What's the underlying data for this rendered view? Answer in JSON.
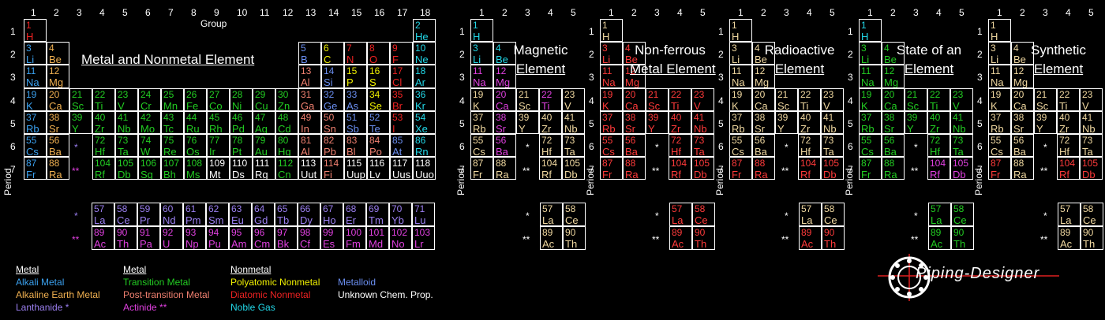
{
  "colors": {
    "alkali_metal": "#3aa0ee",
    "alkaline_earth_metal": "#f0b050",
    "lanthanide": "#9b7ff0",
    "transition_metal": "#22cc22",
    "post_transition_metal": "#f08070",
    "actinide": "#e040e0",
    "polyatomic_nonmetal": "#f0f000",
    "diatomic_nonmetal": "#ee2222",
    "noble_gas": "#22d8e8",
    "metalloid": "#6a8ef0",
    "unknown": "#ffffff",
    "panel_highlight": "#ff3a3a",
    "panel_plain": "#f0d8a0"
  },
  "main": {
    "group_label": "Group",
    "period_label": "Period",
    "title": "Metal and Nonmetal Element",
    "group_numbers": [
      "1",
      "2",
      "3",
      "4",
      "5",
      "6",
      "7",
      "8",
      "9",
      "10",
      "11",
      "12",
      "13",
      "14",
      "15",
      "16",
      "17",
      "18"
    ],
    "period_numbers": [
      "1",
      "2",
      "3",
      "4",
      "5",
      "6",
      "7"
    ],
    "lanthanide_marker": "*",
    "actinide_marker": "**"
  },
  "elements": [
    {
      "n": "1",
      "s": "H",
      "p": 1,
      "g": 1,
      "c": "diatomic_nonmetal"
    },
    {
      "n": "2",
      "s": "He",
      "p": 1,
      "g": 18,
      "c": "noble_gas"
    },
    {
      "n": "3",
      "s": "Li",
      "p": 2,
      "g": 1,
      "c": "alkali_metal"
    },
    {
      "n": "4",
      "s": "Be",
      "p": 2,
      "g": 2,
      "c": "alkaline_earth_metal"
    },
    {
      "n": "5",
      "s": "B",
      "p": 2,
      "g": 13,
      "c": "metalloid"
    },
    {
      "n": "6",
      "s": "C",
      "p": 2,
      "g": 14,
      "c": "polyatomic_nonmetal"
    },
    {
      "n": "7",
      "s": "N",
      "p": 2,
      "g": 15,
      "c": "diatomic_nonmetal"
    },
    {
      "n": "8",
      "s": "O",
      "p": 2,
      "g": 16,
      "c": "diatomic_nonmetal"
    },
    {
      "n": "9",
      "s": "F",
      "p": 2,
      "g": 17,
      "c": "diatomic_nonmetal"
    },
    {
      "n": "10",
      "s": "Ne",
      "p": 2,
      "g": 18,
      "c": "noble_gas"
    },
    {
      "n": "11",
      "s": "Na",
      "p": 3,
      "g": 1,
      "c": "alkali_metal"
    },
    {
      "n": "12",
      "s": "Mg",
      "p": 3,
      "g": 2,
      "c": "alkaline_earth_metal"
    },
    {
      "n": "13",
      "s": "Al",
      "p": 3,
      "g": 13,
      "c": "post_transition_metal"
    },
    {
      "n": "14",
      "s": "Si",
      "p": 3,
      "g": 14,
      "c": "metalloid"
    },
    {
      "n": "15",
      "s": "P",
      "p": 3,
      "g": 15,
      "c": "polyatomic_nonmetal"
    },
    {
      "n": "16",
      "s": "S",
      "p": 3,
      "g": 16,
      "c": "polyatomic_nonmetal"
    },
    {
      "n": "17",
      "s": "Cl",
      "p": 3,
      "g": 17,
      "c": "diatomic_nonmetal"
    },
    {
      "n": "18",
      "s": "Ar",
      "p": 3,
      "g": 18,
      "c": "noble_gas"
    },
    {
      "n": "19",
      "s": "K",
      "p": 4,
      "g": 1,
      "c": "alkali_metal"
    },
    {
      "n": "20",
      "s": "Ca",
      "p": 4,
      "g": 2,
      "c": "alkaline_earth_metal"
    },
    {
      "n": "21",
      "s": "Sc",
      "p": 4,
      "g": 3,
      "c": "transition_metal"
    },
    {
      "n": "22",
      "s": "Ti",
      "p": 4,
      "g": 4,
      "c": "transition_metal"
    },
    {
      "n": "23",
      "s": "V",
      "p": 4,
      "g": 5,
      "c": "transition_metal"
    },
    {
      "n": "24",
      "s": "Cr",
      "p": 4,
      "g": 6,
      "c": "transition_metal"
    },
    {
      "n": "25",
      "s": "Mn",
      "p": 4,
      "g": 7,
      "c": "transition_metal"
    },
    {
      "n": "26",
      "s": "Fe",
      "p": 4,
      "g": 8,
      "c": "transition_metal"
    },
    {
      "n": "27",
      "s": "Co",
      "p": 4,
      "g": 9,
      "c": "transition_metal"
    },
    {
      "n": "28",
      "s": "Ni",
      "p": 4,
      "g": 10,
      "c": "transition_metal"
    },
    {
      "n": "29",
      "s": "Cu",
      "p": 4,
      "g": 11,
      "c": "transition_metal"
    },
    {
      "n": "30",
      "s": "Zn",
      "p": 4,
      "g": 12,
      "c": "transition_metal"
    },
    {
      "n": "31",
      "s": "Ga",
      "p": 4,
      "g": 13,
      "c": "post_transition_metal"
    },
    {
      "n": "32",
      "s": "Ge",
      "p": 4,
      "g": 14,
      "c": "metalloid"
    },
    {
      "n": "33",
      "s": "As",
      "p": 4,
      "g": 15,
      "c": "metalloid"
    },
    {
      "n": "34",
      "s": "Se",
      "p": 4,
      "g": 16,
      "c": "polyatomic_nonmetal"
    },
    {
      "n": "35",
      "s": "Br",
      "p": 4,
      "g": 17,
      "c": "diatomic_nonmetal"
    },
    {
      "n": "36",
      "s": "Kr",
      "p": 4,
      "g": 18,
      "c": "noble_gas"
    },
    {
      "n": "37",
      "s": "Rb",
      "p": 5,
      "g": 1,
      "c": "alkali_metal"
    },
    {
      "n": "38",
      "s": "Sr",
      "p": 5,
      "g": 2,
      "c": "alkaline_earth_metal"
    },
    {
      "n": "39",
      "s": "Y",
      "p": 5,
      "g": 3,
      "c": "transition_metal"
    },
    {
      "n": "40",
      "s": "Zr",
      "p": 5,
      "g": 4,
      "c": "transition_metal"
    },
    {
      "n": "41",
      "s": "Nb",
      "p": 5,
      "g": 5,
      "c": "transition_metal"
    },
    {
      "n": "42",
      "s": "Mo",
      "p": 5,
      "g": 6,
      "c": "transition_metal"
    },
    {
      "n": "43",
      "s": "Tc",
      "p": 5,
      "g": 7,
      "c": "transition_metal"
    },
    {
      "n": "44",
      "s": "Ru",
      "p": 5,
      "g": 8,
      "c": "transition_metal"
    },
    {
      "n": "45",
      "s": "Rh",
      "p": 5,
      "g": 9,
      "c": "transition_metal"
    },
    {
      "n": "46",
      "s": "Pd",
      "p": 5,
      "g": 10,
      "c": "transition_metal"
    },
    {
      "n": "47",
      "s": "Ag",
      "p": 5,
      "g": 11,
      "c": "transition_metal"
    },
    {
      "n": "48",
      "s": "Cd",
      "p": 5,
      "g": 12,
      "c": "transition_metal"
    },
    {
      "n": "49",
      "s": "In",
      "p": 5,
      "g": 13,
      "c": "post_transition_metal"
    },
    {
      "n": "50",
      "s": "Sn",
      "p": 5,
      "g": 14,
      "c": "post_transition_metal"
    },
    {
      "n": "51",
      "s": "Sb",
      "p": 5,
      "g": 15,
      "c": "metalloid"
    },
    {
      "n": "52",
      "s": "Te",
      "p": 5,
      "g": 16,
      "c": "metalloid"
    },
    {
      "n": "53",
      "s": "I",
      "p": 5,
      "g": 17,
      "c": "diatomic_nonmetal"
    },
    {
      "n": "54",
      "s": "Xe",
      "p": 5,
      "g": 18,
      "c": "noble_gas"
    },
    {
      "n": "55",
      "s": "Cs",
      "p": 6,
      "g": 1,
      "c": "alkali_metal"
    },
    {
      "n": "56",
      "s": "Ba",
      "p": 6,
      "g": 2,
      "c": "alkaline_earth_metal"
    },
    {
      "n": "72",
      "s": "Hf",
      "p": 6,
      "g": 4,
      "c": "transition_metal"
    },
    {
      "n": "73",
      "s": "Ta",
      "p": 6,
      "g": 5,
      "c": "transition_metal"
    },
    {
      "n": "74",
      "s": "W",
      "p": 6,
      "g": 6,
      "c": "transition_metal"
    },
    {
      "n": "75",
      "s": "Re",
      "p": 6,
      "g": 7,
      "c": "transition_metal"
    },
    {
      "n": "76",
      "s": "Os",
      "p": 6,
      "g": 8,
      "c": "transition_metal"
    },
    {
      "n": "77",
      "s": "Ir",
      "p": 6,
      "g": 9,
      "c": "transition_metal"
    },
    {
      "n": "78",
      "s": "Pt",
      "p": 6,
      "g": 10,
      "c": "transition_metal"
    },
    {
      "n": "79",
      "s": "Au",
      "p": 6,
      "g": 11,
      "c": "transition_metal"
    },
    {
      "n": "80",
      "s": "Hg",
      "p": 6,
      "g": 12,
      "c": "transition_metal"
    },
    {
      "n": "81",
      "s": "Al",
      "p": 6,
      "g": 13,
      "c": "post_transition_metal"
    },
    {
      "n": "82",
      "s": "Pb",
      "p": 6,
      "g": 14,
      "c": "post_transition_metal"
    },
    {
      "n": "83",
      "s": "Bl",
      "p": 6,
      "g": 15,
      "c": "post_transition_metal"
    },
    {
      "n": "84",
      "s": "Po",
      "p": 6,
      "g": 16,
      "c": "post_transition_metal"
    },
    {
      "n": "85",
      "s": "At",
      "p": 6,
      "g": 17,
      "c": "metalloid"
    },
    {
      "n": "86",
      "s": "Rn",
      "p": 6,
      "g": 18,
      "c": "noble_gas"
    },
    {
      "n": "87",
      "s": "Fr",
      "p": 7,
      "g": 1,
      "c": "alkali_metal"
    },
    {
      "n": "88",
      "s": "Ra",
      "p": 7,
      "g": 2,
      "c": "alkaline_earth_metal"
    },
    {
      "n": "104",
      "s": "Rf",
      "p": 7,
      "g": 4,
      "c": "transition_metal"
    },
    {
      "n": "105",
      "s": "Db",
      "p": 7,
      "g": 5,
      "c": "transition_metal"
    },
    {
      "n": "106",
      "s": "Sg",
      "p": 7,
      "g": 6,
      "c": "transition_metal"
    },
    {
      "n": "107",
      "s": "Bh",
      "p": 7,
      "g": 7,
      "c": "transition_metal"
    },
    {
      "n": "108",
      "s": "Ms",
      "p": 7,
      "g": 8,
      "c": "transition_metal"
    },
    {
      "n": "109",
      "s": "Mt",
      "p": 7,
      "g": 9,
      "c": "unknown"
    },
    {
      "n": "110",
      "s": "Ds",
      "p": 7,
      "g": 10,
      "c": "unknown"
    },
    {
      "n": "111",
      "s": "Rg",
      "p": 7,
      "g": 11,
      "c": "unknown"
    },
    {
      "n": "112",
      "s": "Cn",
      "p": 7,
      "g": 12,
      "c": "transition_metal"
    },
    {
      "n": "113",
      "s": "Uut",
      "p": 7,
      "g": 13,
      "c": "unknown"
    },
    {
      "n": "114",
      "s": "Fi",
      "p": 7,
      "g": 14,
      "c": "post_transition_metal"
    },
    {
      "n": "115",
      "s": "Uup",
      "p": 7,
      "g": 15,
      "c": "unknown"
    },
    {
      "n": "116",
      "s": "Lv",
      "p": 7,
      "g": 16,
      "c": "unknown"
    },
    {
      "n": "117",
      "s": "Uus",
      "p": 7,
      "g": 17,
      "c": "unknown"
    },
    {
      "n": "118",
      "s": "Uuo",
      "p": 7,
      "g": 18,
      "c": "unknown"
    }
  ],
  "lanthanides": [
    {
      "n": "57",
      "s": "La"
    },
    {
      "n": "58",
      "s": "Ce"
    },
    {
      "n": "59",
      "s": "Pr"
    },
    {
      "n": "60",
      "s": "Nd"
    },
    {
      "n": "61",
      "s": "Pm"
    },
    {
      "n": "62",
      "s": "Sm"
    },
    {
      "n": "63",
      "s": "Eu"
    },
    {
      "n": "64",
      "s": "Gd"
    },
    {
      "n": "65",
      "s": "Tb"
    },
    {
      "n": "66",
      "s": "Dy"
    },
    {
      "n": "67",
      "s": "Ho"
    },
    {
      "n": "68",
      "s": "Er"
    },
    {
      "n": "69",
      "s": "Tm"
    },
    {
      "n": "70",
      "s": "Yb"
    },
    {
      "n": "71",
      "s": "Lu"
    }
  ],
  "actinides": [
    {
      "n": "89",
      "s": "Ac"
    },
    {
      "n": "90",
      "s": "Th"
    },
    {
      "n": "91",
      "s": "Pa"
    },
    {
      "n": "92",
      "s": "U"
    },
    {
      "n": "93",
      "s": "Np"
    },
    {
      "n": "94",
      "s": "Pu"
    },
    {
      "n": "95",
      "s": "Am"
    },
    {
      "n": "96",
      "s": "Cm"
    },
    {
      "n": "97",
      "s": "Bk"
    },
    {
      "n": "98",
      "s": "Cf"
    },
    {
      "n": "99",
      "s": "Es"
    },
    {
      "n": "100",
      "s": "Fm"
    },
    {
      "n": "101",
      "s": "Md"
    },
    {
      "n": "102",
      "s": "No"
    },
    {
      "n": "103",
      "s": "Lr"
    }
  ],
  "mini_panels": [
    {
      "title": [
        "Magnetic",
        "Element"
      ],
      "highlight_mode": "custom",
      "custom_colors": {
        "1": "noble_gas",
        "3": "noble_gas",
        "4": "noble_gas",
        "11": "actinide",
        "12": "actinide",
        "20": "actinide",
        "38": "actinide",
        "56": "actinide",
        "22": "actinide",
        "24": "actinide",
        "26": "actinide",
        "27": "actinide",
        "28": "actinide",
        "25": "actinide"
      }
    },
    {
      "title": [
        "Non-ferrous",
        "Metal Element"
      ],
      "highlight_mode": "nonferrous"
    },
    {
      "title": [
        "Radioactive",
        "Element"
      ],
      "highlight_mode": "radioactive"
    },
    {
      "title": [
        "State of an",
        "Element"
      ],
      "highlight_mode": "state"
    },
    {
      "title": [
        "Synthetic",
        "Element"
      ],
      "highlight_mode": "synthetic"
    }
  ],
  "mini_group_numbers": [
    "1",
    "2",
    "3",
    "4",
    "5"
  ],
  "legend": {
    "col1": {
      "heading": "Metal",
      "items": [
        {
          "label": "Alkali Metal",
          "c": "alkali_metal"
        },
        {
          "label": "Alkaline Earth Metal",
          "c": "alkaline_earth_metal"
        },
        {
          "label": "Lanthanide *",
          "c": "lanthanide"
        }
      ]
    },
    "col2": {
      "heading": "Metal",
      "items": [
        {
          "label": "Transition Metal",
          "c": "transition_metal"
        },
        {
          "label": "Post-transition Metal",
          "c": "post_transition_metal"
        },
        {
          "label": "Actinide **",
          "c": "actinide"
        }
      ]
    },
    "col3": {
      "heading": "Nonmetal",
      "items": [
        {
          "label": "Polyatomic Nonmetal",
          "c": "polyatomic_nonmetal"
        },
        {
          "label": "Diatomic Nonmetal",
          "c": "diatomic_nonmetal"
        },
        {
          "label": "Noble Gas",
          "c": "noble_gas"
        }
      ]
    },
    "col4": {
      "items": [
        {
          "label": "Metalloid",
          "c": "metalloid"
        },
        {
          "label": "Unknown Chem. Prop.",
          "c": "unknown"
        }
      ]
    }
  },
  "logo": {
    "text": "Piping-Designer"
  }
}
